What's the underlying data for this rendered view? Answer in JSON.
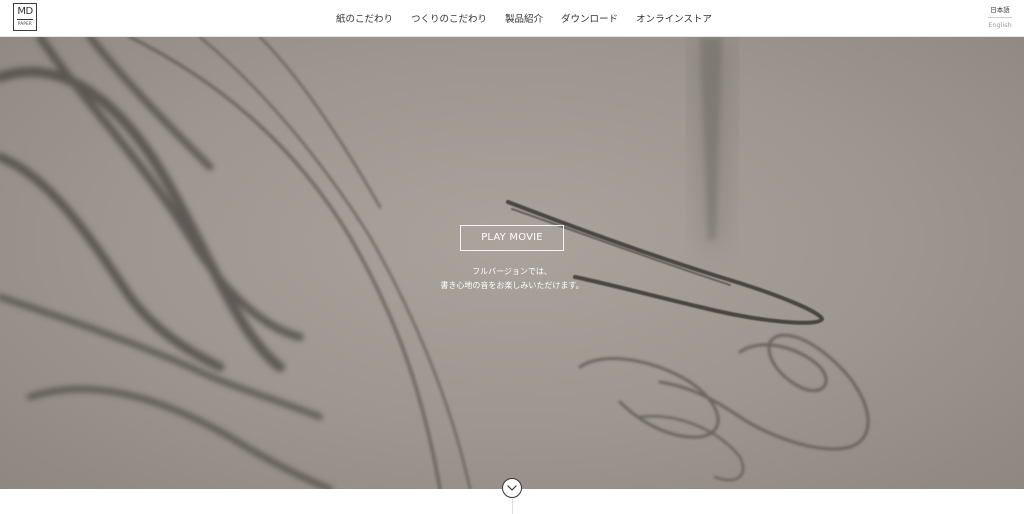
{
  "header": {
    "logo": {
      "top": "MD",
      "bottom": "PAPER"
    },
    "nav": [
      {
        "label": "紙のこだわり"
      },
      {
        "label": "つくりのこだわり"
      },
      {
        "label": "製品紹介"
      },
      {
        "label": "ダウンロード"
      },
      {
        "label": "オンラインストア"
      }
    ],
    "language": {
      "current": "日本語",
      "alternate": "English"
    }
  },
  "hero": {
    "play_label": "PLAY MOVIE",
    "caption_line1": "フルバージョンでは、",
    "caption_line2": "書き心地の音をお楽しみいただけます。"
  },
  "scroll_indicator": {
    "icon": "chevron-down-icon"
  },
  "colors": {
    "hero_background": "#9d9690",
    "pencil_stroke": "#4a4541",
    "text_dark": "#333333",
    "text_muted": "#9a9a9a"
  }
}
